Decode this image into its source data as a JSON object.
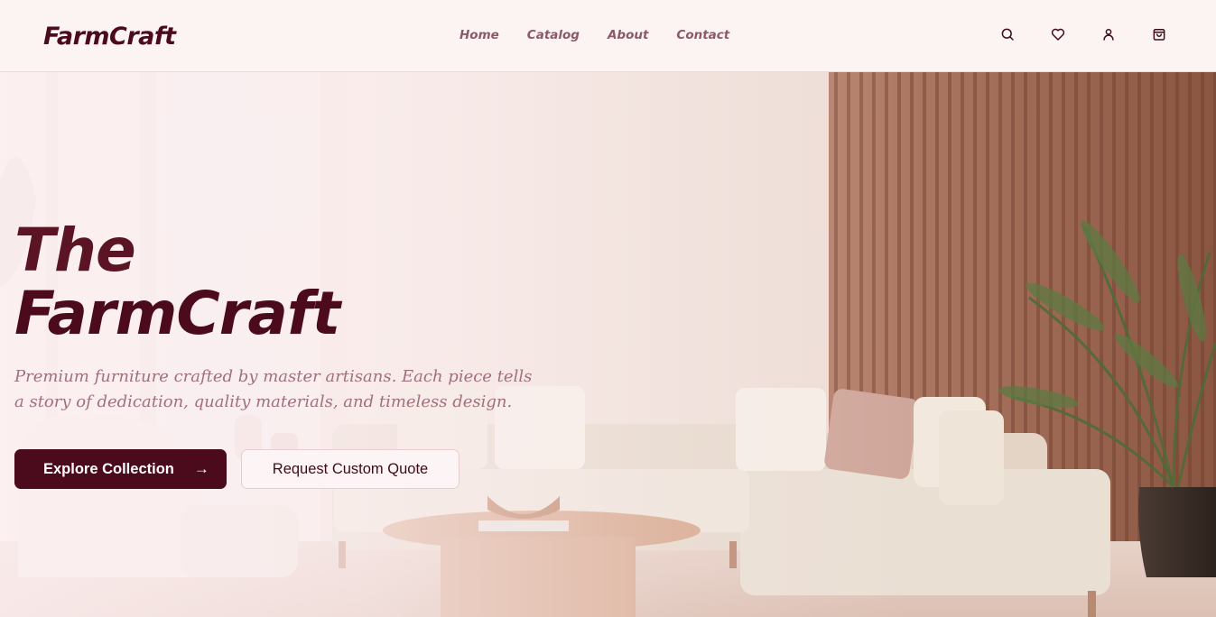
{
  "brand": {
    "name": "FarmCraft"
  },
  "nav": {
    "items": [
      {
        "label": "Home"
      },
      {
        "label": "Catalog"
      },
      {
        "label": "About"
      },
      {
        "label": "Contact"
      }
    ]
  },
  "header_icons": [
    "search-icon",
    "heart-icon",
    "user-icon",
    "shopping-bag-icon"
  ],
  "hero": {
    "title_line1": "The",
    "title_line2": "FarmCraft",
    "subtitle": "Premium furniture crafted by master artisans. Each piece tells a story of dedication, quality materials, and timeless design.",
    "primary_button": "Explore Collection",
    "secondary_button": "Request Custom Quote"
  },
  "colors": {
    "brand": "#4b0b1c",
    "header_bg": "#fcf3f3",
    "nav_text": "#8a5a6a",
    "subtitle_text": "#a0707f"
  }
}
